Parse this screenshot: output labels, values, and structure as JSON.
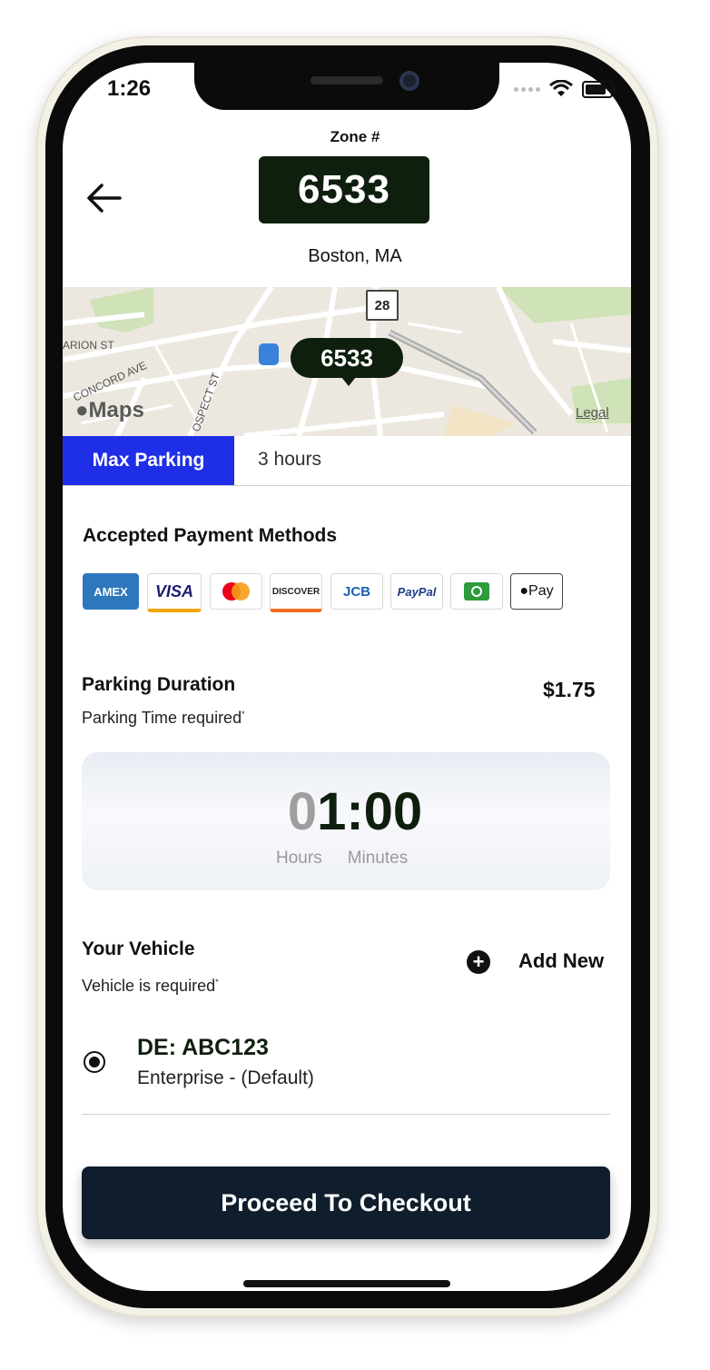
{
  "status_bar": {
    "time": "1:26"
  },
  "header": {
    "zone_label": "Zone #",
    "zone_number": "6533",
    "city": "Boston, MA"
  },
  "map": {
    "pin_label": "6533",
    "route_shield": "28",
    "brand": "Maps",
    "legal": "Legal",
    "streets": [
      "ARION ST",
      "CONCORD AVE",
      "OSPECT ST"
    ]
  },
  "max_parking": {
    "label": "Max Parking",
    "value": "3 hours"
  },
  "payment": {
    "title": "Accepted Payment Methods",
    "methods": [
      "AMEX",
      "VISA",
      "mastercard-icon",
      "DISCOVER",
      "JCB",
      "PayPal",
      "wallet-icon",
      "Pay"
    ]
  },
  "duration": {
    "title": "Parking Duration",
    "subtitle": "Parking Time required",
    "price": "$1.75",
    "timer_hours_dim": "0",
    "timer_rest": "1:00",
    "hours_label": "Hours",
    "minutes_label": "Minutes"
  },
  "vehicle": {
    "title": "Your Vehicle",
    "subtitle": "Vehicle is required",
    "add_label": "Add New",
    "add_symbol": "+",
    "plate": "DE: ABC123",
    "type": "Enterprise - (Default)"
  },
  "checkout": {
    "label": "Proceed To Checkout"
  },
  "colors": {
    "accent": "#1f2fe8",
    "dark_green": "#0e1f0e",
    "navy": "#0f1d2c"
  }
}
